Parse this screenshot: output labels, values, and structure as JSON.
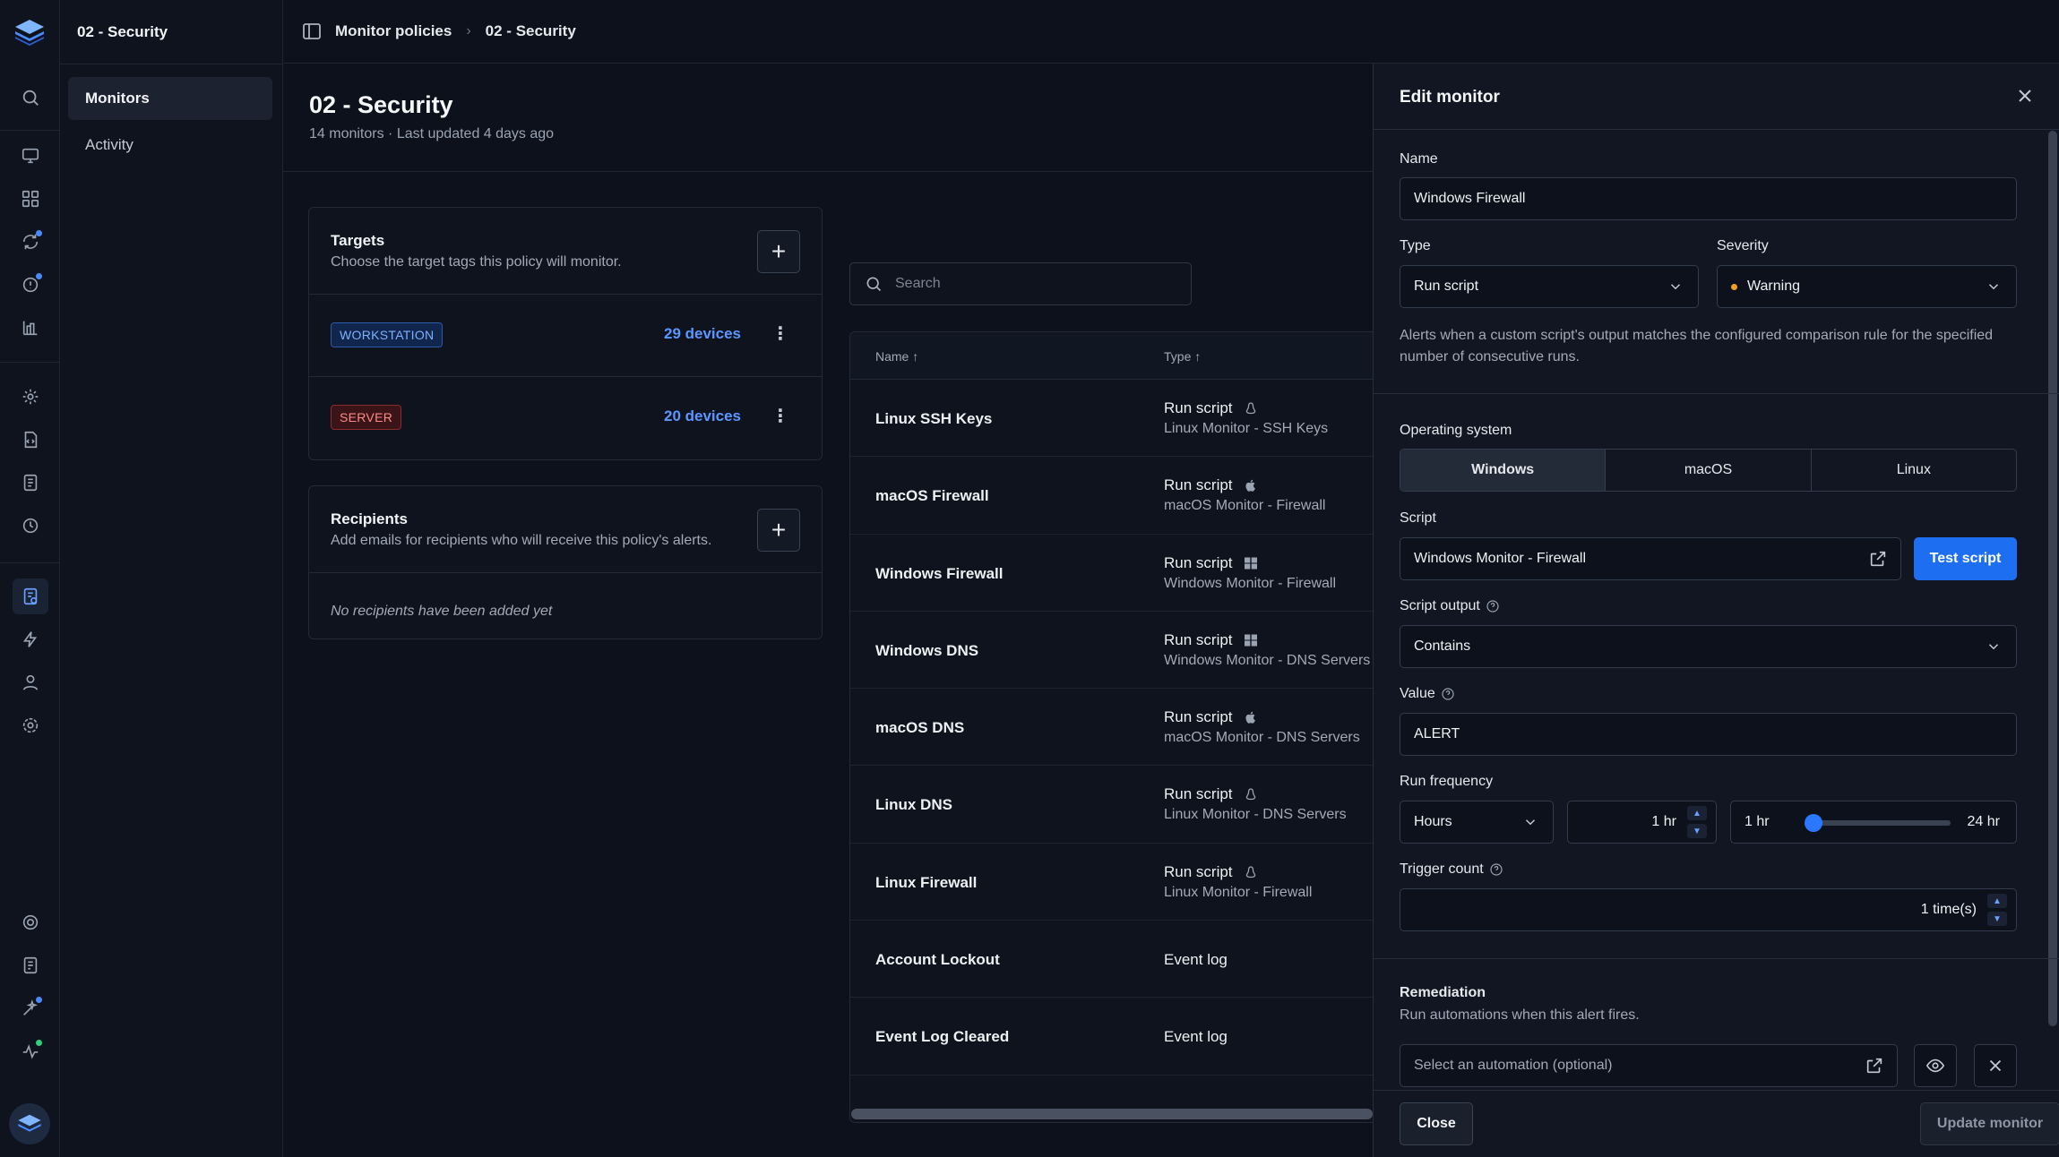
{
  "sidebar": {
    "title": "02 - Security",
    "items": [
      {
        "label": "Monitors",
        "active": true
      },
      {
        "label": "Activity",
        "active": false
      }
    ]
  },
  "breadcrumb": {
    "parent": "Monitor policies",
    "separator": "›",
    "current": "02 - Security"
  },
  "page": {
    "title": "02 - Security",
    "subtitle": "14 monitors · Last updated 4 days ago"
  },
  "targets": {
    "title": "Targets",
    "description": "Choose the target tags this policy will monitor.",
    "add_label": "+",
    "rows": [
      {
        "tag": "WORKSTATION",
        "devices": "29 devices",
        "color": "#7fb0ff"
      },
      {
        "tag": "SERVER",
        "devices": "20 devices",
        "color": "#ff8a8a"
      }
    ]
  },
  "recipients": {
    "title": "Recipients",
    "description": "Add emails for recipients who will receive this policy's alerts.",
    "add_label": "+",
    "empty": "No recipients have been added yet"
  },
  "search": {
    "placeholder": "Search"
  },
  "table": {
    "columns": [
      {
        "label": "Name",
        "sort": "asc"
      },
      {
        "label": "Type",
        "sort": "asc"
      }
    ],
    "sort_glyph": "↑",
    "rows": [
      {
        "name": "Linux SSH Keys",
        "type": "Run script",
        "os": "linux-icon",
        "script": "Linux Monitor - SSH Keys"
      },
      {
        "name": "macOS Firewall",
        "type": "Run script",
        "os": "apple-icon",
        "script": "macOS Monitor - Firewall"
      },
      {
        "name": "Windows Firewall",
        "type": "Run script",
        "os": "windows-icon",
        "script": "Windows Monitor - Firewall"
      },
      {
        "name": "Windows DNS",
        "type": "Run script",
        "os": "windows-icon",
        "script": "Windows Monitor - DNS Servers"
      },
      {
        "name": "macOS DNS",
        "type": "Run script",
        "os": "apple-icon",
        "script": "macOS Monitor - DNS Servers"
      },
      {
        "name": "Linux DNS",
        "type": "Run script",
        "os": "linux-icon",
        "script": "Linux Monitor - DNS Servers"
      },
      {
        "name": "Linux Firewall",
        "type": "Run script",
        "os": "linux-icon",
        "script": "Linux Monitor - Firewall"
      },
      {
        "name": "Account Lockout",
        "type": "Event log",
        "os": "",
        "script": ""
      },
      {
        "name": "Event Log Cleared",
        "type": "Event log",
        "os": "",
        "script": ""
      }
    ]
  },
  "drawer": {
    "title": "Edit monitor",
    "name_label": "Name",
    "name_value": "Windows Firewall",
    "type_label": "Type",
    "type_value": "Run script",
    "severity_label": "Severity",
    "severity_value": "Warning",
    "severity_color": "#f0a020",
    "help": "Alerts when a custom script's output matches the configured comparison rule for the specified number of consecutive runs.",
    "os_label": "Operating system",
    "os_options": [
      {
        "label": "Windows",
        "selected": true
      },
      {
        "label": "macOS",
        "selected": false
      },
      {
        "label": "Linux",
        "selected": false
      }
    ],
    "script_label": "Script",
    "script_value": "Windows Monitor - Firewall",
    "test_script": "Test script",
    "output_label": "Script output",
    "output_value": "Contains",
    "value_label": "Value",
    "value_value": "ALERT",
    "freq_label": "Run frequency",
    "freq_unit": "Hours",
    "freq_value": "1 hr",
    "slider_min": "1 hr",
    "slider_max": "24 hr",
    "slider_value": 1,
    "slider_range": [
      1,
      24
    ],
    "trigger_label": "Trigger count",
    "trigger_value": "1 time(s)",
    "remediation_title": "Remediation",
    "remediation_desc": "Run automations when this alert fires.",
    "automation_placeholder": "Select an automation (optional)",
    "close": "Close",
    "update": "Update monitor"
  },
  "colors": {
    "accent": "#1d6ef0",
    "link": "#5b97ff",
    "background": "#0c111b"
  }
}
